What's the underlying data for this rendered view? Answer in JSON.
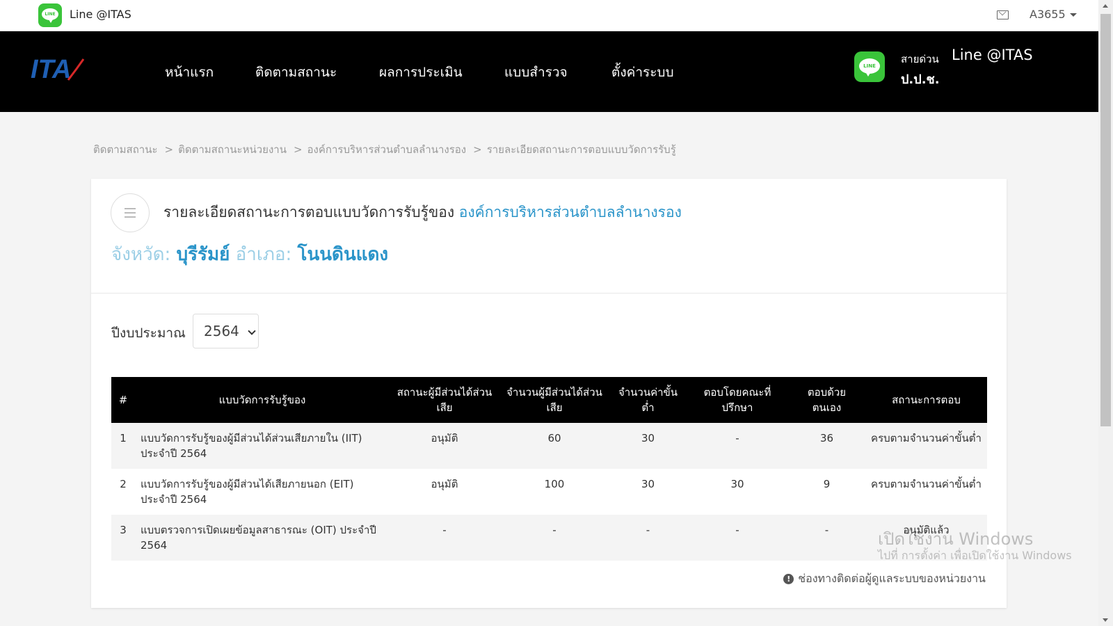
{
  "topbar": {
    "logo_text": "LINE",
    "title": "Line @ITAS",
    "user": "A3655"
  },
  "navbar": {
    "logo": "ITA",
    "items": [
      "หน้าแรก",
      "ติดตามสถานะ",
      "ผลการประเมิน",
      "แบบสำรวจ",
      "ตั้งค่าระบบ"
    ],
    "hotline_label": "สายด่วน",
    "hotline_line": "Line @ITAS",
    "hotline_org": "ป.ป.ช."
  },
  "breadcrumb": [
    "ติดตามสถานะ",
    "ติดตามสถานะหน่วยงาน",
    "องค์การบริหารส่วนตำบลลำนางรอง",
    "รายละเอียดสถานะการตอบแบบวัดการรับรู้"
  ],
  "card": {
    "title_prefix": "รายละเอียดสถานะการตอบแบบวัดการรับรู้ของ",
    "organization": "องค์การบริหารส่วนตำบลลำนางรอง",
    "province_label": "จังหวัด:",
    "province": "บุรีรัมย์",
    "district_label": "อำเภอ:",
    "district": "โนนดินแดง"
  },
  "filter": {
    "label": "ปีงบประมาณ",
    "selected": "2564"
  },
  "table": {
    "headers": [
      "#",
      "แบบวัดการรับรู้ของ",
      "สถานะผู้มีส่วนได้ส่วนเสีย",
      "จำนวนผู้มีส่วนได้ส่วนเสีย",
      "จำนวนค่าขั้นต่ำ",
      "ตอบโดยคณะที่ปรึกษา",
      "ตอบด้วยตนเอง",
      "สถานะการตอบ"
    ],
    "rows": [
      [
        "1",
        "แบบวัดการรับรู้ของผู้มีส่วนได้ส่วนเสียภายใน (IIT) ประจำปี 2564",
        "อนุมัติ",
        "60",
        "30",
        "-",
        "36",
        "ครบตามจำนวนค่าขั้นต่ำ"
      ],
      [
        "2",
        "แบบวัดการรับรู้ของผู้มีส่วนได้เสียภายนอก (EIT) ประจำปี 2564",
        "อนุมัติ",
        "100",
        "30",
        "30",
        "9",
        "ครบตามจำนวนค่าขั้นต่ำ"
      ],
      [
        "3",
        "แบบตรวจการเปิดเผยข้อมูลสาธารณะ (OIT) ประจำปี 2564",
        "-",
        "-",
        "-",
        "-",
        "-",
        "อนุมัติแล้ว"
      ]
    ]
  },
  "contact_link": "ช่องทางติดต่อผู้ดูแลระบบของหน่วยงาน",
  "watermark": {
    "line1": "เปิดใช้งาน Windows",
    "line2": "ไปที่ การตั้งค่า เพื่อเปิดใช้งาน Windows"
  },
  "colors": {
    "navbar_bg": "#000000",
    "line_green": "#3ac43a",
    "accent_blue": "#2a94c9",
    "table_header_bg": "#000000"
  }
}
